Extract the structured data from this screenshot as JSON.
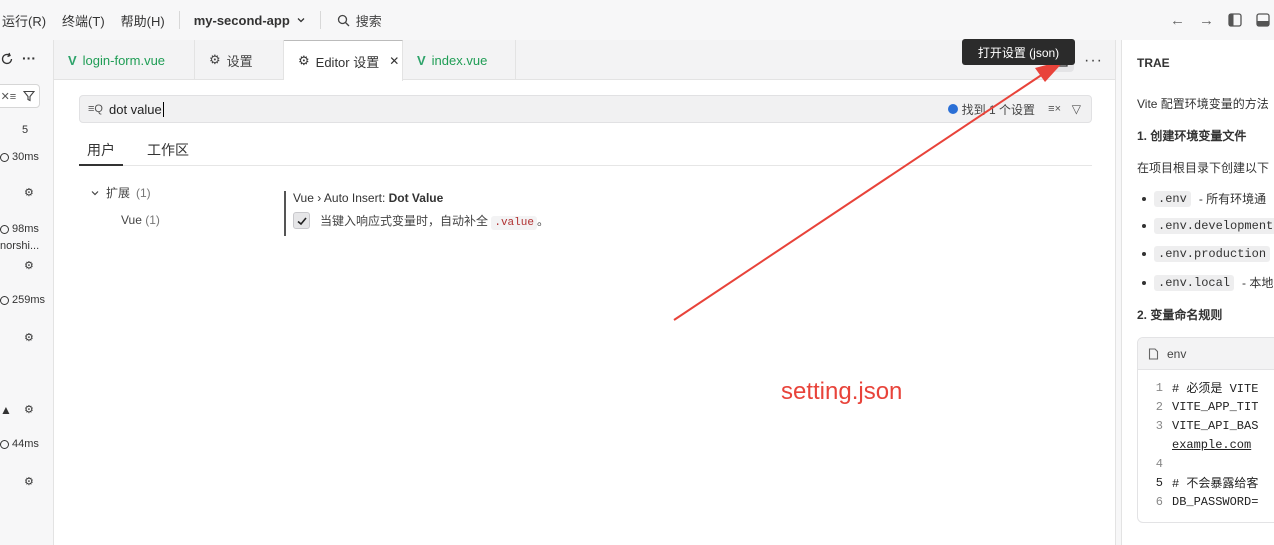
{
  "menu": {
    "items": [
      "运行(R)",
      "终端(T)",
      "帮助(H)"
    ],
    "project": "my-second-app",
    "search_label": "搜索"
  },
  "left_strip": {
    "count": "5",
    "timings": [
      "30ms",
      "98ms",
      "259ms",
      "44ms"
    ],
    "truncated_label": "norshi..."
  },
  "tabs": [
    {
      "label": "login-form.vue",
      "kind": "vue"
    },
    {
      "label": "设置",
      "kind": "settings"
    },
    {
      "label": "Editor 设置",
      "kind": "settings",
      "active": true
    },
    {
      "label": "index.vue",
      "kind": "vue"
    }
  ],
  "settings": {
    "search_value": "dot value",
    "found_text": "找到 1 个设置",
    "scopes": [
      "用户",
      "工作区"
    ],
    "toc": {
      "group": "扩展",
      "group_count": "(1)",
      "item": "Vue",
      "item_count": "(1)"
    },
    "item": {
      "breadcrumb": "Vue › Auto Insert: ",
      "name": "Dot Value",
      "description": "当键入响应式变量时，自动补全",
      "code": ".value",
      "suffix": "。",
      "checked": true
    }
  },
  "tooltip": "打开设置 (json)",
  "annotation": "setting.json",
  "annotation_color": "#e8433a",
  "chat": {
    "title": "TRAE",
    "intro": "Vite 配置环境变量的方法",
    "h1": "1. 创建环境变量文件",
    "p1": "在项目根目录下创建以下",
    "files": [
      {
        "code": ".env",
        "desc": " - 所有环境通"
      },
      {
        "code": ".env.development",
        "desc": ""
      },
      {
        "code": ".env.production",
        "desc": ""
      },
      {
        "code": ".env.local",
        "desc": " - 本地"
      }
    ],
    "h2": "2. 变量命名规则",
    "code_lang": "env",
    "code_lines": [
      {
        "n": "1",
        "text": "# 必须是 VITE"
      },
      {
        "n": "2",
        "text": "VITE_APP_TIT"
      },
      {
        "n": "3",
        "text": "VITE_API_BAS"
      },
      {
        "n": "",
        "text": "example.com"
      },
      {
        "n": "4",
        "text": ""
      },
      {
        "n": "5",
        "text": "# 不会暴露给客"
      },
      {
        "n": "6",
        "text": "DB_PASSWORD="
      }
    ]
  }
}
